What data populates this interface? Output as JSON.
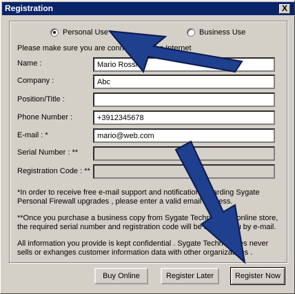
{
  "window": {
    "title": "Registration",
    "close_label": "X"
  },
  "usage": {
    "personal_label": "Personal Use",
    "business_label": "Business Use",
    "selected": "personal"
  },
  "instruction": "Please make sure you are connected to the Internet",
  "fields": {
    "name": {
      "label": "Name :",
      "value": "Mario Rossi"
    },
    "company": {
      "label": "Company :",
      "value": "Abc"
    },
    "position": {
      "label": "Position/Title :",
      "value": ""
    },
    "phone": {
      "label": "Phone Number :",
      "value": "+3912345678"
    },
    "email": {
      "label": "E-mail : *",
      "value": "mario@web.com"
    },
    "serial": {
      "label": "Serial Number : **",
      "value": ""
    },
    "regcode": {
      "label": "Registration Code : **",
      "value": ""
    }
  },
  "notes": {
    "note1": "*In order to receive free e-mail support and notification regarding Sygate Personal Firewall upgrades , please enter a valid email address.",
    "note2": "**Once you purchase a business copy from Sygate Technologies online store, the required serial number and registration code will be sent to you by e-mail.",
    "note3": "All information you provide is kept confidential . Sygate Technologies never sells or exhanges customer information data with other organizations ."
  },
  "buttons": {
    "buy_online": "Buy Online",
    "register_later": "Register Later",
    "register_now": "Register Now"
  },
  "colors": {
    "titlebar": "#0a246a",
    "arrow_fill": "#1f3f8f",
    "arrow_stroke": "#0a1a4a"
  }
}
